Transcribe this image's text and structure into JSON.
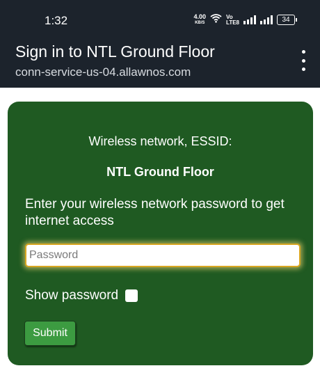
{
  "status_bar": {
    "time": "1:32",
    "network_speed_value": "4.00",
    "network_speed_unit": "KB/S",
    "volte_top": "Vo",
    "volte_bottom": "LTE8",
    "battery": "34",
    "icons": [
      "wifi-icon",
      "signal-icon",
      "signal-icon",
      "battery-icon"
    ]
  },
  "app_bar": {
    "title": "Sign in to NTL Ground Floor",
    "subtitle": "conn-service-us-04.allawnos.com",
    "menu_icon": "more-vertical-icon"
  },
  "form": {
    "essid_label": "Wireless network, ESSID:",
    "essid_name": "NTL Ground Floor",
    "instructions": "Enter your wireless network password to get internet access",
    "password_placeholder": "Password",
    "password_value": "",
    "show_password_label": "Show password",
    "show_password_checked": false,
    "submit_label": "Submit"
  },
  "colors": {
    "bar_background": "#1c232c",
    "card_background": "#1f5a22",
    "submit_background": "#3c9b41",
    "input_focus_border": "#d8a621"
  }
}
